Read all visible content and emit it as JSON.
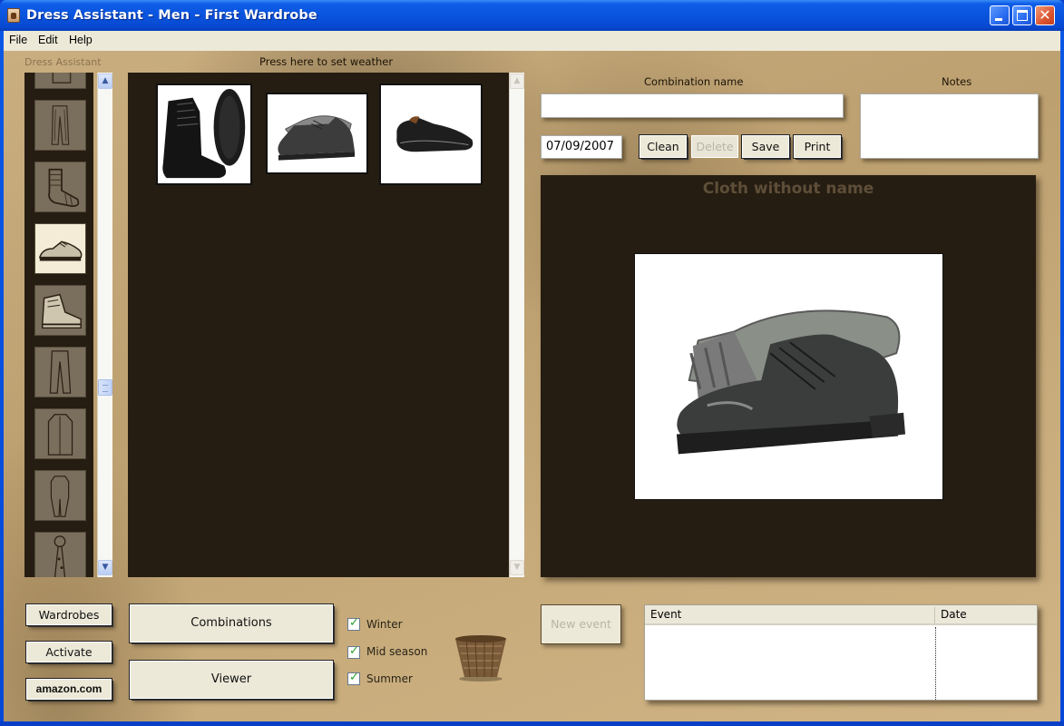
{
  "window": {
    "title": "Dress Assistant - Men - First Wardrobe",
    "controls": {
      "minimize": "minimize",
      "maximize": "maximize",
      "close": "✕"
    }
  },
  "menu": {
    "items": [
      "File",
      "Edit",
      "Help"
    ]
  },
  "brand_label": "Dress Assistant",
  "weather_label": "Press here to set weather",
  "categories": [
    {
      "name": "shirt",
      "selected": false
    },
    {
      "name": "trousers",
      "selected": false
    },
    {
      "name": "socks",
      "selected": false
    },
    {
      "name": "shoes",
      "selected": true
    },
    {
      "name": "sneakers",
      "selected": false
    },
    {
      "name": "jeans",
      "selected": false
    },
    {
      "name": "coat",
      "selected": false
    },
    {
      "name": "suit",
      "selected": false
    },
    {
      "name": "tie",
      "selected": false
    }
  ],
  "items": [
    {
      "name": "black-combat-boots"
    },
    {
      "name": "black-oxford-shoes"
    },
    {
      "name": "black-slip-on-loafers"
    }
  ],
  "combination": {
    "name_label": "Combination name",
    "name_value": "",
    "date": "07/09/2007",
    "notes_label": "Notes",
    "notes_value": ""
  },
  "actions": {
    "clean": "Clean",
    "delete": "Delete",
    "save": "Save",
    "print": "Print"
  },
  "preview": {
    "title": "Cloth without name",
    "item": "black-oxford-shoes"
  },
  "bottom": {
    "wardrobes": "Wardrobes",
    "activate": "Activate",
    "amazon": "amazon.com",
    "combinations": "Combinations",
    "viewer": "Viewer",
    "new_event": "New event"
  },
  "seasons": [
    {
      "label": "Winter",
      "checked": true
    },
    {
      "label": "Mid season",
      "checked": true
    },
    {
      "label": "Summer",
      "checked": true
    }
  ],
  "events": {
    "columns": [
      "Event",
      "Date"
    ],
    "rows": []
  },
  "colors": {
    "titlebar": "#0a54de",
    "panel_dark": "#261d12",
    "background": "#c9ae80",
    "button_face": "#ece9d8",
    "check_green": "#2aa02a"
  }
}
